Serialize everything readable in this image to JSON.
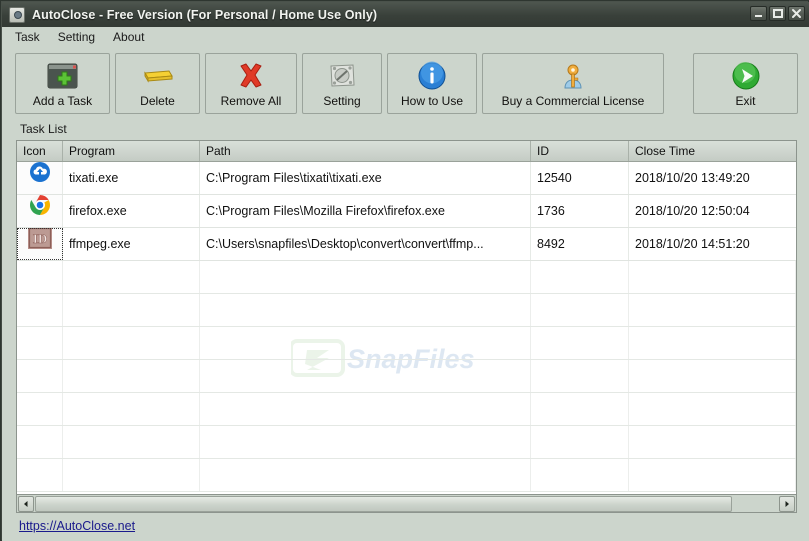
{
  "window": {
    "title": "AutoClose - Free Version (For Personal / Home Use Only)",
    "app_icon": "camera-icon",
    "minimize_label": "Minimize",
    "maximize_label": "Maximize",
    "close_label": "Close"
  },
  "menubar": {
    "items": [
      {
        "label": "Task",
        "name": "menu-task"
      },
      {
        "label": "Setting",
        "name": "menu-setting"
      },
      {
        "label": "About",
        "name": "menu-about"
      }
    ]
  },
  "toolbar": {
    "buttons": [
      {
        "label": "Add a Task",
        "icon": "window-plus-icon"
      },
      {
        "label": "Delete",
        "icon": "yellow-bar-icon"
      },
      {
        "label": "Remove All",
        "icon": "red-x-icon"
      },
      {
        "label": "Setting",
        "icon": "screw-plate-icon"
      },
      {
        "label": "How to Use",
        "icon": "blue-info-icon"
      },
      {
        "label": "Buy a Commercial License",
        "icon": "gold-key-person-icon"
      },
      {
        "label": "Exit",
        "icon": "green-arrow-icon"
      }
    ]
  },
  "list": {
    "label": "Task List",
    "columns": [
      {
        "header": "Icon"
      },
      {
        "header": "Program"
      },
      {
        "header": "Path"
      },
      {
        "header": "ID"
      },
      {
        "header": "Close Time"
      }
    ],
    "rows": [
      {
        "icon": "tixati-cloud-icon",
        "program": "tixati.exe",
        "path": "C:\\Program Files\\tixati\\tixati.exe",
        "id": "12540",
        "close_time": "2018/10/20 13:49:20",
        "selected": false
      },
      {
        "icon": "chrome-icon",
        "program": "firefox.exe",
        "path": "C:\\Program Files\\Mozilla Firefox\\firefox.exe",
        "id": "1736",
        "close_time": "2018/10/20 12:50:04",
        "selected": false
      },
      {
        "icon": "id-badge-icon",
        "program": "ffmpeg.exe",
        "path": "C:\\Users\\snapfiles\\Desktop\\convert\\convert\\ffmp...",
        "id": "8492",
        "close_time": "2018/10/20 14:51:20",
        "selected": true
      }
    ],
    "empty_row_count": 7,
    "watermark_text": "SnapFiles"
  },
  "scrollbar": {
    "left_arrow": "scroll-left",
    "right_arrow": "scroll-right"
  },
  "footer": {
    "link_text": "https://AutoClose.net"
  },
  "colors": {
    "window_chrome": "#3d443e",
    "client_bg": "#ccd5cc",
    "link": "#1a1a8c",
    "header_bg": "#ccd5cc"
  }
}
